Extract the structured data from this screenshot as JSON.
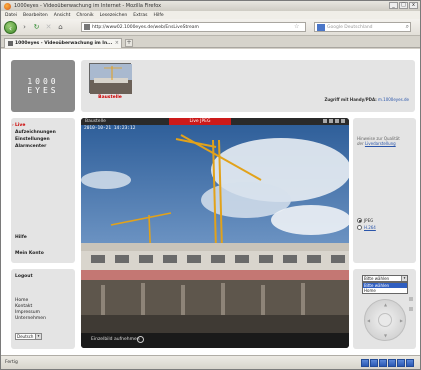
{
  "window": {
    "title": "1000eyes - Videoüberwachung im Internet - Mozilla Firefox",
    "controls": [
      "_",
      "□",
      "x"
    ]
  },
  "menu": [
    "Datei",
    "Bearbeiten",
    "Ansicht",
    "Chronik",
    "Lesezeichen",
    "Extras",
    "Hilfe"
  ],
  "navbar": {
    "url": "http://www02.1000eyes.de/web/EnsLiveStream",
    "search_placeholder": "Google Deutschland"
  },
  "tab": {
    "title": "1000eyes - Videoüberwachung im In...",
    "new_tab": "+"
  },
  "logo": {
    "line1": "1000",
    "line2": "EYES"
  },
  "top_panel": {
    "thumbnail_label": "Baustelle",
    "zugriff_label": "Zugriff mit Handy/PDA:",
    "zugriff_link": "m.1000eyes.de"
  },
  "left_nav": {
    "items": [
      {
        "label": "Live",
        "active": true
      },
      {
        "label": "Aufzeichnungen"
      },
      {
        "label": "Einstellungen"
      },
      {
        "label": "Alarmcenter"
      },
      {
        "label": "Hilfe"
      },
      {
        "label": "Mein Konto"
      }
    ]
  },
  "left_bottom": {
    "heading": "Logout",
    "links": [
      "Home",
      "Kontakt",
      "Impressum",
      "Unternehmen"
    ],
    "language": "Deutsch"
  },
  "video": {
    "camera_name": "Baustelle",
    "mode": "Live JPEG",
    "timestamp": "2010-10-21 14:23:12",
    "snapshot_label": "Einzelbild aufnehmen"
  },
  "right_panel": {
    "quality_text_1": "Hinweise zur Qualität",
    "quality_text_2": "der",
    "quality_link": "Livedarstellung",
    "options": [
      {
        "label": "JPEG",
        "selected": true,
        "link": false
      },
      {
        "label": "H.264",
        "selected": false,
        "link": true
      }
    ]
  },
  "ptz": {
    "select_value": "Bitte wählen",
    "options": [
      "Bitte wählen",
      "Home"
    ],
    "highlighted_index": 0
  },
  "status": {
    "text": "Fertig"
  },
  "colors": {
    "accent_red": "#cc1a1a",
    "link_blue": "#2a55aa",
    "panel_gray": "#e4e4e4",
    "logo_gray": "#8a8a8a"
  }
}
